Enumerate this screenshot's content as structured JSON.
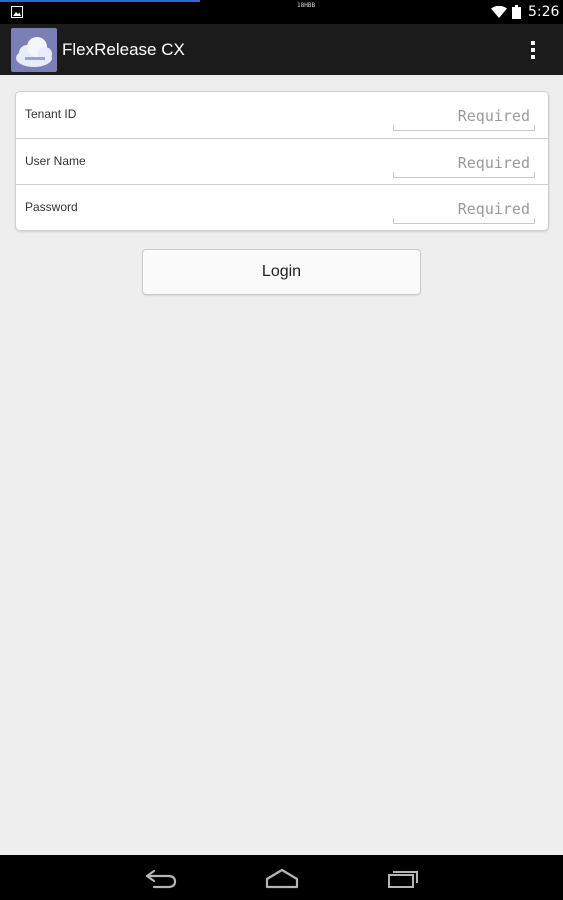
{
  "status_bar": {
    "tiny_text": "18HBB",
    "time": "5:26",
    "icons": [
      "image-notification-icon",
      "wifi-icon",
      "battery-icon"
    ]
  },
  "action_bar": {
    "app_icon": "cloud-icon",
    "title": "FlexRelease CX",
    "overflow_icon": "overflow-menu-icon"
  },
  "form": {
    "fields": [
      {
        "label": "Tenant ID",
        "placeholder": "Required",
        "value": ""
      },
      {
        "label": "User Name",
        "placeholder": "Required",
        "value": ""
      },
      {
        "label": "Password",
        "placeholder": "Required",
        "value": ""
      }
    ]
  },
  "login_button": {
    "label": "Login"
  },
  "nav_bar": {
    "icons": [
      "back-icon",
      "home-icon",
      "recent-apps-icon"
    ]
  },
  "colors": {
    "background": "#eeeeee",
    "action_bar": "#1b1b1b",
    "status_bar": "#000000",
    "app_icon_bg": "#7b7fb8",
    "placeholder": "#9a9a9a"
  }
}
